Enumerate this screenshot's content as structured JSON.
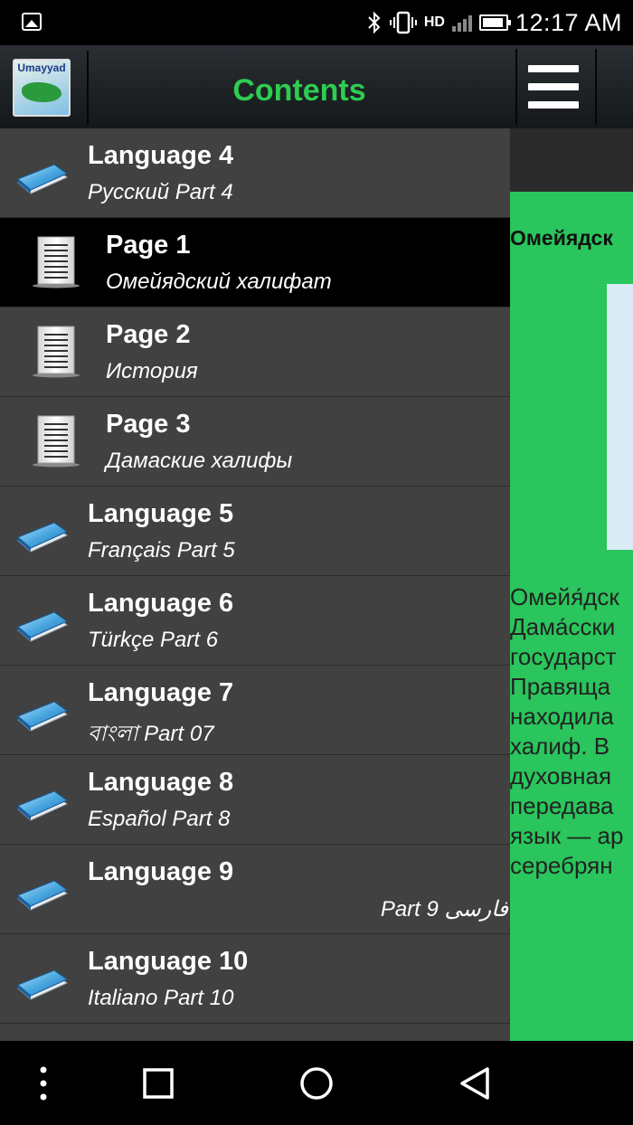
{
  "status_bar": {
    "time": "12:17 AM",
    "network_label": "HD",
    "icons": [
      "gallery-icon",
      "bluetooth-icon",
      "vibrate-icon",
      "signal-icon",
      "battery-icon"
    ]
  },
  "drawer": {
    "title": "Contents",
    "logo_text": "Umayyad",
    "items": [
      {
        "type": "language",
        "title": "Language 4",
        "subtitle": "Русский Part 4"
      },
      {
        "type": "page",
        "title": "Page 1",
        "subtitle": "Омейядский халифат",
        "selected": true
      },
      {
        "type": "page",
        "title": "Page 2",
        "subtitle": "История"
      },
      {
        "type": "page",
        "title": "Page 3",
        "subtitle": "Дамаские халифы"
      },
      {
        "type": "language",
        "title": "Language 5",
        "subtitle": "Français Part 5"
      },
      {
        "type": "language",
        "title": "Language 6",
        "subtitle": "Türkçe Part 6"
      },
      {
        "type": "language",
        "title": "Language 7",
        "subtitle": "বাংলা Part 07"
      },
      {
        "type": "language",
        "title": "Language 8",
        "subtitle": "Español Part 8"
      },
      {
        "type": "language",
        "title": "Language 9",
        "subtitle": "فارسی Part 9",
        "rtl": true
      },
      {
        "type": "language",
        "title": "Language 10",
        "subtitle": "Italiano Part 10"
      }
    ]
  },
  "main": {
    "title": "Омейядск",
    "text": "Омейя́дск\nДама́сски\nгосударст\nПравяща\nнаходила\nхалиф. В \nдуховная\nпередава\nязык — ар\nсеребрян"
  },
  "colors": {
    "accent_green": "#2ecc4f",
    "content_green": "#2ac55c",
    "drawer_bg": "#414141",
    "selected_bg": "#000000"
  }
}
